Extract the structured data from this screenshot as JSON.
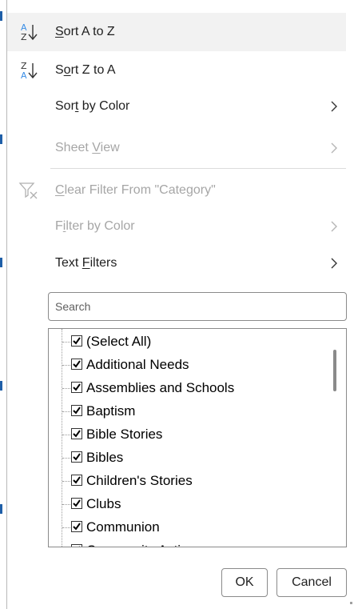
{
  "menu": {
    "sort_az": {
      "pre": "",
      "key": "S",
      "post": "ort A to Z"
    },
    "sort_za": {
      "pre": "S",
      "key": "o",
      "post": "rt Z to A"
    },
    "sort_by_color": {
      "pre": "Sor",
      "key": "t",
      "post": " by Color"
    },
    "sheet_view": {
      "pre": "Sheet ",
      "key": "V",
      "post": "iew"
    },
    "clear_filter": {
      "pre": "",
      "key": "C",
      "post": "lear Filter From \"Category\""
    },
    "filter_by_color": {
      "pre": "F",
      "key": "i",
      "post": "lter by Color"
    },
    "text_filters": {
      "pre": "Text ",
      "key": "F",
      "post": "ilters"
    },
    "sort_icon_letters": {
      "az_top": "A",
      "az_bottom": "Z",
      "za_top": "Z",
      "za_bottom": "A",
      "arrow": "↓"
    }
  },
  "search": {
    "placeholder": "Search"
  },
  "list": {
    "items": [
      "(Select All)",
      "Additional Needs",
      "Assemblies and Schools",
      "Baptism",
      "Bible Stories",
      "Bibles",
      "Children's Stories",
      "Clubs",
      "Communion",
      "Community Action"
    ],
    "all_checked": true
  },
  "buttons": {
    "ok": "OK",
    "cancel": "Cancel"
  },
  "colors": {
    "accent_blue": "#3a8ee6",
    "disabled_text": "#a6a6a6",
    "hover_bg": "#f2f2f2"
  }
}
